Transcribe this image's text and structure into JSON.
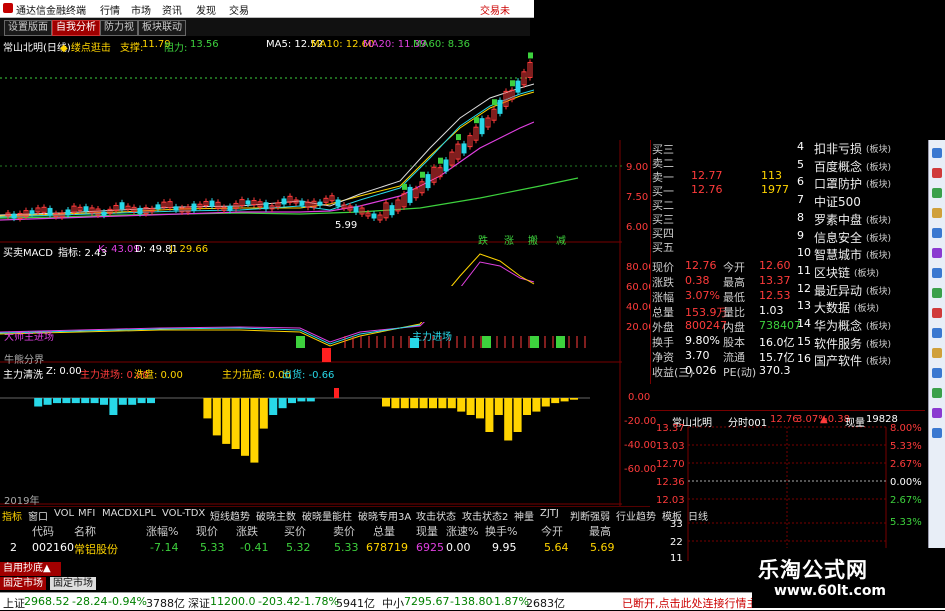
{
  "window": {
    "title": "通达信金融终端",
    "menu": [
      "行情",
      "市场",
      "资讯",
      "发现",
      "交易"
    ],
    "corner_link": "交易未"
  },
  "tabs": [
    {
      "label": "设置版面",
      "active": false
    },
    {
      "label": "自我分析",
      "active": true
    },
    {
      "label": "防力视",
      "active": false
    },
    {
      "label": "板块联动",
      "active": false
    }
  ],
  "main_chart": {
    "stock_period": "常山北明(日线)",
    "indicator": "◆ 缕点逛击",
    "support_label": "支撑:",
    "support_value": "11.79",
    "resistance_label": "阻力:",
    "resistance_value": "13.56",
    "ma5": "MA5: 12.52",
    "ma10": "MA10: 12.60",
    "ma20": "MA20: 11.39",
    "ma60": "MA60: 8.36",
    "low_mark": "5.99",
    "y_ticks": [
      "9.00",
      "7.50",
      "6.00"
    ],
    "stamps": [
      "跌",
      "涨",
      "搬",
      "减"
    ]
  },
  "macd_panel": {
    "name": "买卖MACD",
    "indicator": "指标: 2.43",
    "k": "K: 43.09",
    "d": "D: 49.81",
    "j": "J: 29.66",
    "left_label": "大师主进场",
    "left_label2": "牛熊分界",
    "right_label": "主力进场",
    "y_ticks": [
      "80.00",
      "60.00",
      "40.00",
      "20.00"
    ]
  },
  "fund_panel": {
    "name": "主力清洗",
    "z": "Z: 0.00",
    "inflow": "主力进场: 0.00",
    "wash": "洗盘: 0.00",
    "pull": "主力拉高: 0.00",
    "exit": "出货: -0.66",
    "y_ticks": [
      "0.00",
      "-20.00",
      "-40.00",
      "-60.00"
    ],
    "year_label": "2019年"
  },
  "chart_data": {
    "type": "bar",
    "title": "主力清洗",
    "ylim": [
      -65,
      5
    ],
    "values": [
      0,
      0,
      0,
      -5,
      -4,
      -3,
      -3,
      -3,
      -3,
      -3,
      -4,
      -10,
      -4,
      -4,
      -3,
      -3,
      0,
      0,
      0,
      0,
      0,
      -12,
      -22,
      -27,
      -30,
      -34,
      -38,
      -18,
      -10,
      -6,
      -3,
      -2,
      -2,
      0,
      0,
      0,
      0,
      0,
      0,
      0,
      -5,
      -6,
      -6,
      -6,
      -6,
      -6,
      -6,
      -6,
      -8,
      -10,
      -12,
      -20,
      -10,
      -25,
      -20,
      -10,
      -8,
      -5,
      -3,
      -2,
      -1,
      0
    ]
  },
  "quote": {
    "order_book": [
      {
        "label": "买三",
        "price": "",
        "vol": ""
      },
      {
        "label": "卖二",
        "price": "",
        "vol": ""
      },
      {
        "label": "卖一",
        "price": "12.77",
        "vol": "113"
      },
      {
        "label": "买一",
        "price": "12.76",
        "vol": "1977"
      },
      {
        "label": "买二",
        "price": "",
        "vol": ""
      },
      {
        "label": "买三",
        "price": "",
        "vol": ""
      },
      {
        "label": "买四",
        "price": "",
        "vol": ""
      },
      {
        "label": "买五",
        "price": "",
        "vol": ""
      }
    ],
    "stats": [
      {
        "k1": "现价",
        "v1": "12.76",
        "k2": "今开",
        "v2": "12.60"
      },
      {
        "k1": "涨跌",
        "v1": "0.38",
        "k2": "最高",
        "v2": "13.37"
      },
      {
        "k1": "涨幅",
        "v1": "3.07%",
        "k2": "最低",
        "v2": "12.53"
      },
      {
        "k1": "总量",
        "v1": "153.9万",
        "k2": "量比",
        "v2": "1.03"
      },
      {
        "k1": "外盘",
        "v1": "800247",
        "k2": "内盘",
        "v2": "738407"
      },
      {
        "k1": "换手",
        "v1": "9.80%",
        "k2": "股本",
        "v2": "16.0亿"
      },
      {
        "k1": "净资",
        "v1": "3.70",
        "k2": "流通",
        "v2": "15.7亿"
      },
      {
        "k1": "收益(三)",
        "v1": "0.026",
        "k2": "PE(动)",
        "v2": "370.3"
      }
    ]
  },
  "concepts": [
    {
      "num": "4",
      "name": "扣非亏损",
      "tag": "(板块)"
    },
    {
      "num": "5",
      "name": "百度概念",
      "tag": "(板块)"
    },
    {
      "num": "6",
      "name": "口罩防护",
      "tag": "(板块)"
    },
    {
      "num": "7",
      "name": "中证500",
      "tag": ""
    },
    {
      "num": "8",
      "name": "罗素中盘",
      "tag": "(板块)"
    },
    {
      "num": "9",
      "name": "信息安全",
      "tag": "(板块)"
    },
    {
      "num": "10",
      "name": "智慧城市",
      "tag": "(板块)"
    },
    {
      "num": "11",
      "name": "区块链",
      "tag": "(板块)"
    },
    {
      "num": "12",
      "name": "最近异动",
      "tag": "(板块)"
    },
    {
      "num": "13",
      "name": "大数据",
      "tag": "(板块)"
    },
    {
      "num": "14",
      "name": "华为概念",
      "tag": "(板块)"
    },
    {
      "num": "15",
      "name": "软件服务",
      "tag": "(板块)"
    },
    {
      "num": "16",
      "name": "国产软件",
      "tag": "(板块)"
    }
  ],
  "mini_chart": {
    "stock": "常山北明",
    "period": "分时001",
    "price": "12.76",
    "pct": "3.07%",
    "chg": "▲0.38",
    "vol_label": "现量",
    "vol": "19828",
    "left_ticks": [
      "13.37",
      "13.03",
      "12.70",
      "12.36",
      "12.03"
    ],
    "right_ticks": [
      "8.00%",
      "5.33%",
      "2.67%",
      "0.00%",
      "2.67%",
      "5.33%"
    ],
    "vol_ticks": [
      "33",
      "22",
      "11"
    ]
  },
  "bottom_tabs_strip": [
    "指标",
    "窗口",
    "VOL",
    "MFI",
    "MACD",
    "XLPL",
    "VOL-TDX",
    "短线趋势",
    "破晓主数",
    "破晓量能柱",
    "破晓专用3A",
    "攻击状态",
    "攻击状态2",
    "神量",
    "ZJTJ",
    "判断强弱",
    "行业趋势",
    "模板",
    "日线"
  ],
  "grid": {
    "headers": [
      "代码",
      "名称",
      "涨幅%",
      "现价",
      "涨跌",
      "买价",
      "卖价",
      "总量",
      "现量",
      "涨速%",
      "换手%",
      "今开",
      "最高"
    ],
    "row": {
      "idx": "2",
      "code": "002160",
      "name": "常铝股份",
      "pct": "-7.14",
      "price": "5.33",
      "chg": "-0.41",
      "bid": "5.32",
      "ask": "5.33",
      "vol": "678719",
      "cur": "6925",
      "speed": "0.00",
      "turnover": "9.95",
      "open": "5.64",
      "high": "5.69"
    }
  },
  "self_select": "自用抄底▲",
  "market_tabs": [
    "固定市场",
    "固定市场"
  ],
  "status": {
    "sh_label": "上证",
    "sh_val": "2968.52",
    "sh_chg": "-28.24",
    "sh_pct": "-0.94%",
    "sh_amt": "3788亿",
    "sz_label": "深证",
    "sz_val": "11200.0",
    "sz_chg": "-203.42",
    "sz_pct": "-1.78%",
    "sz_amt": "5941亿",
    "zx_label": "中小",
    "zx_val": "7295.67",
    "zx_chg": "-138.80",
    "zx_pct": "-1.87%",
    "zx_amt": "2683亿",
    "note": "已断开,点击此处连接行情主"
  },
  "watermark": {
    "title": "乐淘公式网",
    "url": "www.60lt.com"
  }
}
